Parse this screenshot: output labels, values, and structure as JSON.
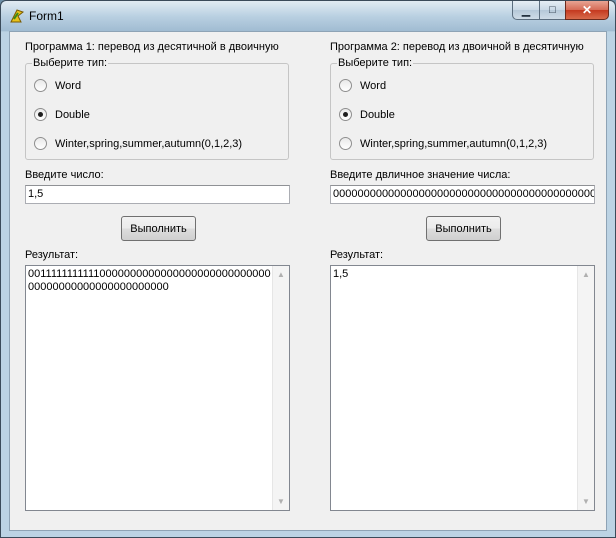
{
  "window": {
    "title": "Form1",
    "icons": {
      "app": "delphi-app-icon",
      "minimize": "minimize-icon",
      "maximize": "maximize-icon",
      "close": "close-icon"
    },
    "min_glyph": "▁",
    "max_glyph": "□",
    "close_glyph": "✕"
  },
  "program1": {
    "heading": "Программа 1: перевод из десятичной в двоичную",
    "group_label": "Выберите тип:",
    "options": [
      {
        "label": "Word",
        "checked": false
      },
      {
        "label": "Double",
        "checked": true
      },
      {
        "label": "Winter,spring,summer,autumn(0,1,2,3)",
        "checked": false
      }
    ],
    "input_label": "Введите число:",
    "input_value": "1,5",
    "button_label": "Выполнить",
    "result_label": "Результат:",
    "result_text": "0011111111111000000000000000000000000000000000000000000000000000"
  },
  "program2": {
    "heading": "Программа 2: перевод из двоичной в десятичную",
    "group_label": "Выберите тип:",
    "options": [
      {
        "label": "Word",
        "checked": false
      },
      {
        "label": "Double",
        "checked": true
      },
      {
        "label": "Winter,spring,summer,autumn(0,1,2,3)",
        "checked": false
      }
    ],
    "input_label": "Введите двличное значение числа:",
    "input_value": "0000000000000000000000000000000000000000000000",
    "button_label": "Выполнить",
    "result_label": "Результат:",
    "result_text": "1,5"
  },
  "scrollbar": {
    "up_glyph": "▲",
    "down_glyph": "▼"
  }
}
